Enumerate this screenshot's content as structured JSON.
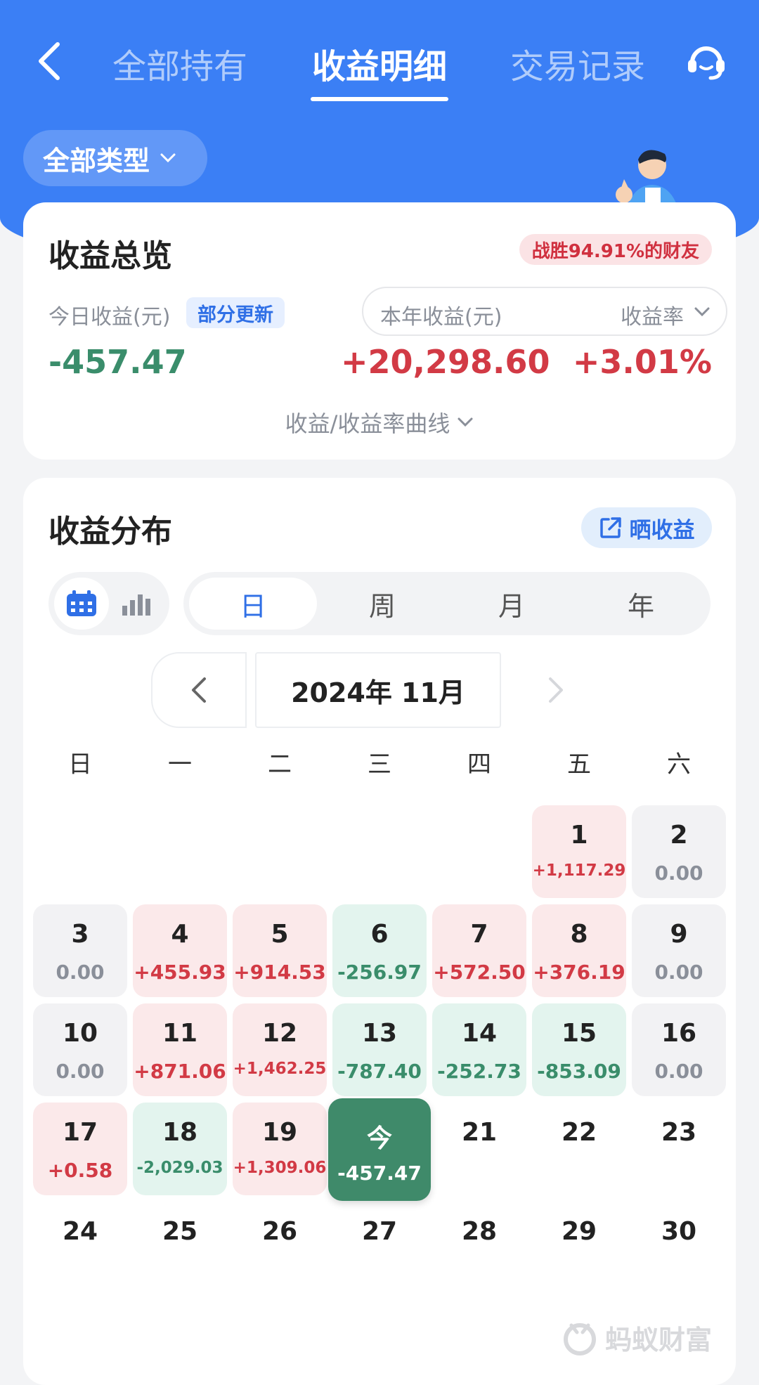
{
  "nav": {
    "tabs": [
      {
        "label": "全部持有"
      },
      {
        "label": "收益明细"
      },
      {
        "label": "交易记录"
      }
    ],
    "active_tab": "收益明细"
  },
  "filter": {
    "type_label": "全部类型"
  },
  "overview": {
    "title": "收益总览",
    "win_badge": "战胜94.91%的财友",
    "today_label": "今日收益(元)",
    "partial_update": "部分更新",
    "today_value": "-457.47",
    "year_label": "本年收益(元)",
    "rate_label": "收益率",
    "year_value": "+20,298.60",
    "rate_value": "+3.01%",
    "curve_toggle": "收益/收益率曲线"
  },
  "distribution": {
    "title": "收益分布",
    "share_label": "晒收益",
    "periods": [
      "日",
      "周",
      "月",
      "年"
    ],
    "active_period": "日",
    "month_label": "2024年 11月",
    "weekdays": [
      "日",
      "一",
      "二",
      "三",
      "四",
      "五",
      "六"
    ],
    "days": [
      {
        "day": "1",
        "value": "+1,117.29",
        "kind": "pos"
      },
      {
        "day": "2",
        "value": "0.00",
        "kind": "zero"
      },
      {
        "day": "3",
        "value": "0.00",
        "kind": "zero"
      },
      {
        "day": "4",
        "value": "+455.93",
        "kind": "pos"
      },
      {
        "day": "5",
        "value": "+914.53",
        "kind": "pos"
      },
      {
        "day": "6",
        "value": "-256.97",
        "kind": "neg"
      },
      {
        "day": "7",
        "value": "+572.50",
        "kind": "pos"
      },
      {
        "day": "8",
        "value": "+376.19",
        "kind": "pos"
      },
      {
        "day": "9",
        "value": "0.00",
        "kind": "zero"
      },
      {
        "day": "10",
        "value": "0.00",
        "kind": "zero"
      },
      {
        "day": "11",
        "value": "+871.06",
        "kind": "pos"
      },
      {
        "day": "12",
        "value": "+1,462.25",
        "kind": "pos"
      },
      {
        "day": "13",
        "value": "-787.40",
        "kind": "neg"
      },
      {
        "day": "14",
        "value": "-252.73",
        "kind": "neg"
      },
      {
        "day": "15",
        "value": "-853.09",
        "kind": "neg"
      },
      {
        "day": "16",
        "value": "0.00",
        "kind": "zero"
      },
      {
        "day": "17",
        "value": "+0.58",
        "kind": "pos"
      },
      {
        "day": "18",
        "value": "-2,029.03",
        "kind": "neg"
      },
      {
        "day": "19",
        "value": "+1,309.06",
        "kind": "pos"
      },
      {
        "day": "今",
        "value": "-457.47",
        "kind": "today"
      },
      {
        "day": "21",
        "value": "",
        "kind": "future"
      },
      {
        "day": "22",
        "value": "",
        "kind": "future"
      },
      {
        "day": "23",
        "value": "",
        "kind": "future"
      },
      {
        "day": "24",
        "value": "",
        "kind": "future"
      },
      {
        "day": "25",
        "value": "",
        "kind": "future"
      },
      {
        "day": "26",
        "value": "",
        "kind": "future"
      },
      {
        "day": "27",
        "value": "",
        "kind": "future"
      },
      {
        "day": "28",
        "value": "",
        "kind": "future"
      },
      {
        "day": "29",
        "value": "",
        "kind": "future"
      },
      {
        "day": "30",
        "value": "",
        "kind": "future"
      }
    ],
    "watermark": "蚂蚁财富"
  },
  "colors": {
    "brand_blue": "#3b7ff5",
    "gain_red": "#d23a45",
    "loss_green": "#3a8d6b",
    "today_green": "#3f8a6a"
  },
  "icons": [
    "back-arrow-icon",
    "customer-service-icon",
    "chevron-down-icon",
    "calendar-icon",
    "bar-chart-icon",
    "share-icon",
    "chevron-left-icon",
    "chevron-right-icon",
    "ant-logo-icon"
  ]
}
